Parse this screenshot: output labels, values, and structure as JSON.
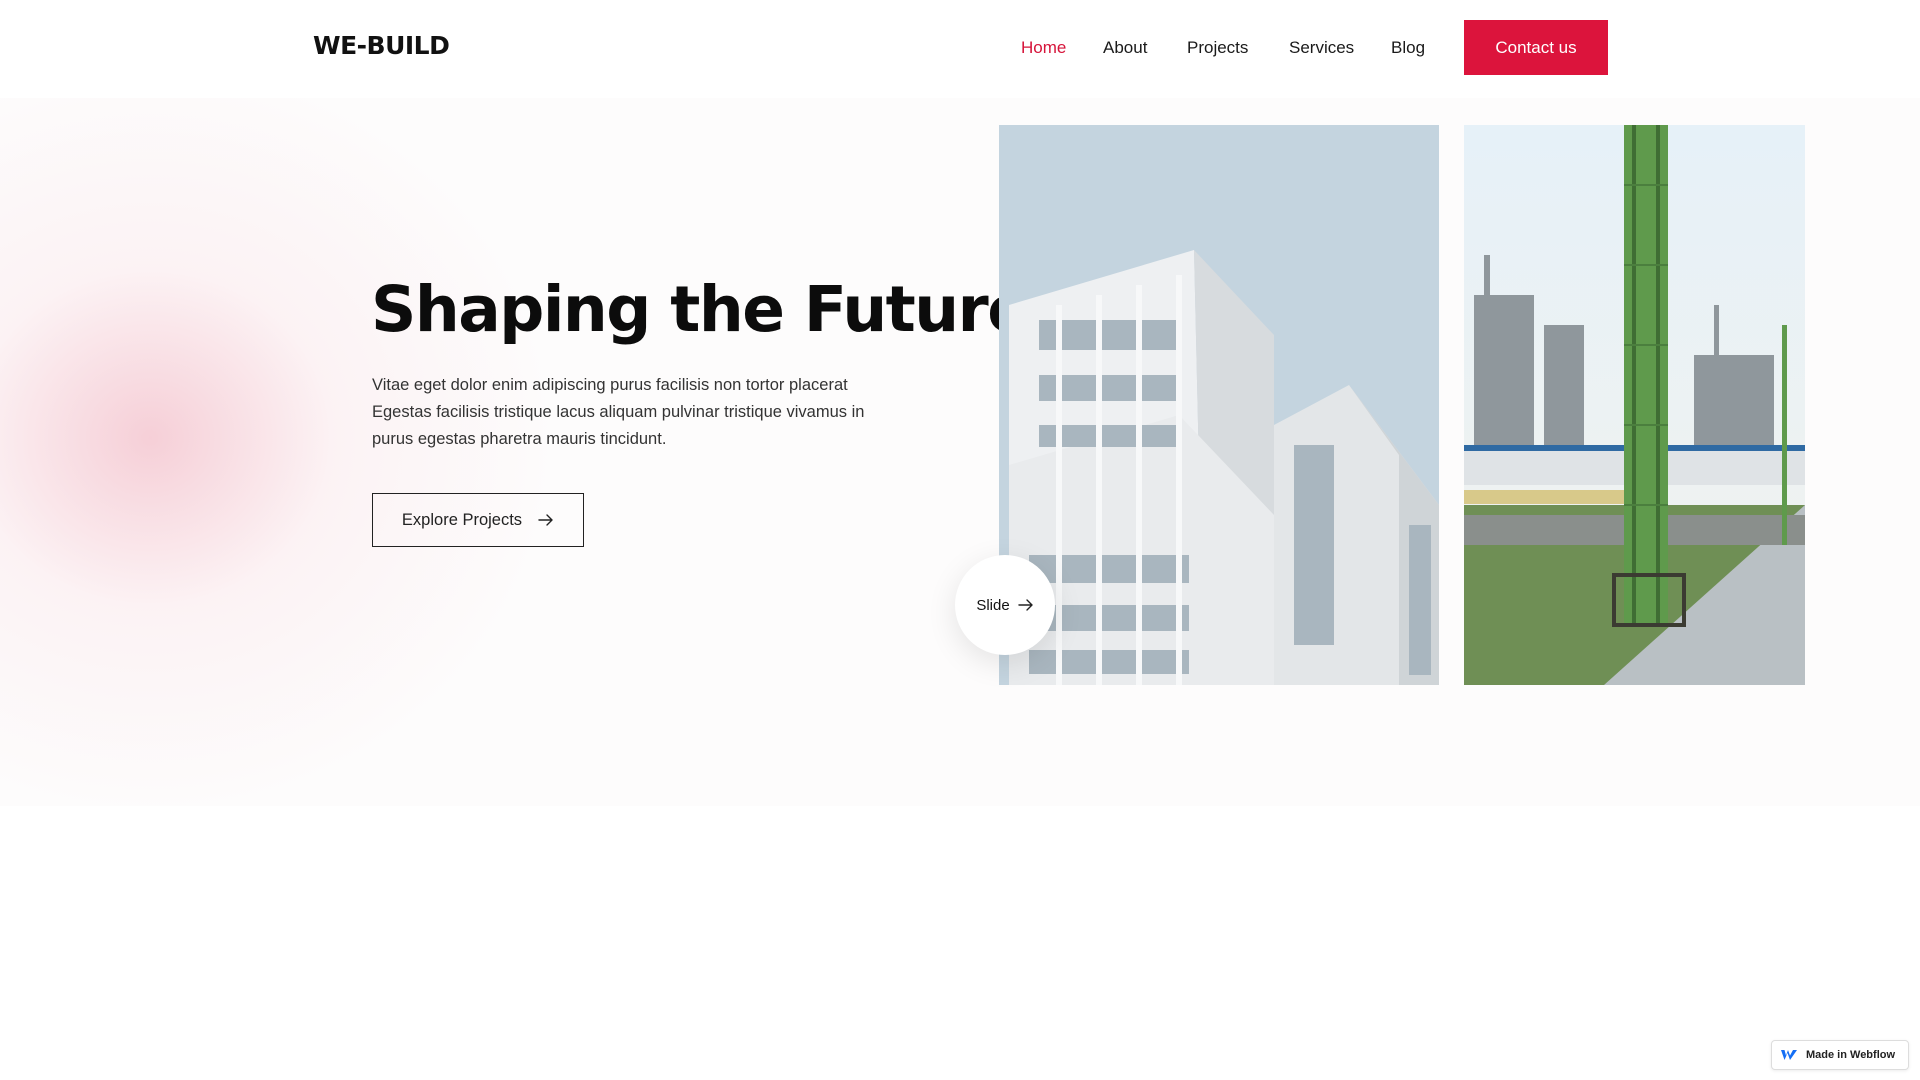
{
  "header": {
    "logo": "WE-BUILD",
    "nav": [
      {
        "label": "Home",
        "active": true
      },
      {
        "label": "About",
        "active": false
      },
      {
        "label": "Projects",
        "active": false
      },
      {
        "label": "Services",
        "active": false
      },
      {
        "label": "Blog",
        "active": false
      }
    ],
    "contact_label": "Contact us"
  },
  "hero": {
    "title": "Shaping the Future",
    "description": "Vitae eget dolor enim adipiscing purus facilisis non tortor placerat Egestas facilisis tristique lacus aliquam pulvinar tristique vivamus in purus egestas pharetra mauris tincidunt.",
    "explore_label": "Explore Projects",
    "slide_label": "Slide"
  },
  "badge": {
    "label": "Made in Webflow"
  },
  "colors": {
    "accent": "#dc143c",
    "text": "#111111",
    "hero_bg": "#fdfcfc"
  },
  "icons": [
    "arrow-right-icon",
    "webflow-logo-icon"
  ]
}
